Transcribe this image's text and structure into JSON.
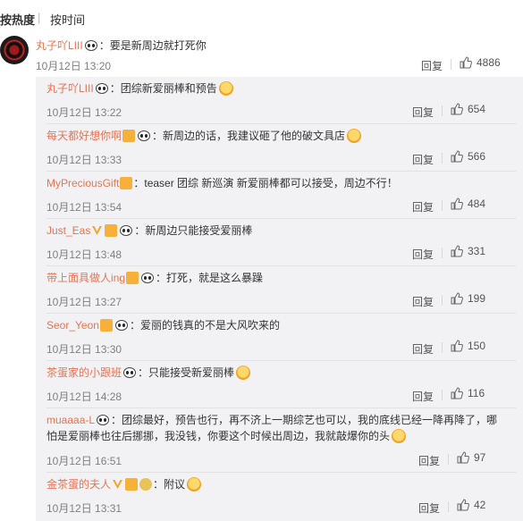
{
  "sort": {
    "hot": "按热度",
    "time": "按时间"
  },
  "labels": {
    "reply": "回复"
  },
  "colors": {
    "link": "#eb7350",
    "reply_bg": "#f2f2f5",
    "meta": "#808080"
  },
  "main": {
    "user": "丸子吖LIII",
    "text": "：要是新周边就打死你",
    "time": "10月12日 13:20",
    "likes": "4886",
    "icons": [
      "avatar",
      "panda-badge-icon",
      "thumbs-up-icon"
    ]
  },
  "replies": [
    {
      "user": "丸子吖LIII",
      "text": "：团综新爱丽棒和预告",
      "time": "10月12日 13:22",
      "likes": "654",
      "icons": [
        "panda-badge-icon",
        "surprised-emoji-icon"
      ]
    },
    {
      "user": "每天都好想你啊",
      "text": "：新周边的话，我建议砸了他的破文具店",
      "time": "10月12日 13:33",
      "likes": "566",
      "icons": [
        "fan-badge-icon",
        "panda-badge-icon",
        "fist-emoji-icon"
      ]
    },
    {
      "user": "MyPreciousGift",
      "text": "：teaser 团综 新巡演 新爱丽棒都可以接受，周边不行！",
      "time": "10月12日 13:54",
      "likes": "484",
      "icons": [
        "fan-badge-icon"
      ]
    },
    {
      "user": "Just_Eas",
      "text": "：新周边只能接受爱丽棒",
      "time": "10月12日 13:48",
      "likes": "331",
      "icons": [
        "vip-v-icon",
        "fan-badge-icon",
        "panda-badge-icon"
      ]
    },
    {
      "user": "带上面具做人ing",
      "text": "：打死，就是这么暴躁",
      "time": "10月12日 13:27",
      "likes": "199",
      "icons": [
        "fan-badge-icon",
        "panda-badge-icon"
      ]
    },
    {
      "user": "Seor_Yeon",
      "text": "：爱丽的钱真的不是大风吹来的",
      "time": "10月12日 13:30",
      "likes": "150",
      "icons": [
        "fan-badge-icon",
        "panda-badge-icon"
      ]
    },
    {
      "user": "茶蛋家的小跟班",
      "text": "：只能接受新爱丽棒",
      "time": "10月12日 14:28",
      "likes": "116",
      "icons": [
        "panda-badge-icon",
        "grin-emoji-icon"
      ]
    },
    {
      "user": "muaaaa-L",
      "text": "：团综最好，预告也行，再不济上一期综艺也可以，我的底线已经一降再降了，哪",
      "text2": "怕是爱丽棒也往后挪挪，我没钱，你要这个时候出周边，我就敲爆你的头",
      "time": "10月12日 16:51",
      "likes": "97",
      "icons": [
        "panda-badge-icon",
        "angry-emoji-icon"
      ]
    },
    {
      "user": "金茶蛋的夫人",
      "text": "：附议",
      "time": "10月12日 13:31",
      "likes": "42",
      "icons": [
        "vip-v-icon",
        "fan-badge-icon",
        "medal-badge-icon",
        "fist-emoji-icon"
      ]
    }
  ]
}
